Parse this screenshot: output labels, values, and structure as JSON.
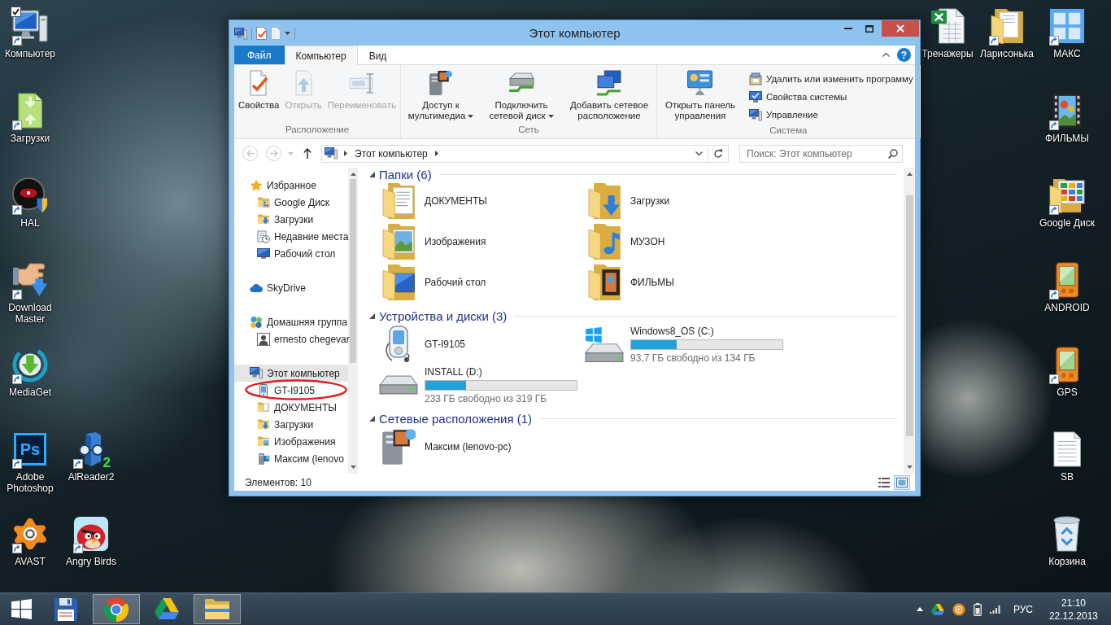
{
  "desktop": {
    "icons": [
      {
        "label": "Компьютер",
        "kind": "computer",
        "shortcut": true,
        "checked": true
      },
      {
        "label": "Загрузки",
        "kind": "arrows-folder",
        "shortcut": true,
        "checked": false
      },
      {
        "label": "HAL",
        "kind": "eye",
        "shortcut": true,
        "checked": false
      },
      {
        "label": "Download Master",
        "kind": "hand",
        "shortcut": true,
        "checked": false
      },
      {
        "label": "MediaGet",
        "kind": "ring-arrow",
        "shortcut": true,
        "checked": false
      },
      {
        "label": "Adobe Photoshop",
        "kind": "ps",
        "logo_text": "Ps",
        "shortcut": true,
        "checked": false
      },
      {
        "label": "AlReader2",
        "kind": "reader",
        "logo_text": "2",
        "shortcut": true,
        "checked": false
      },
      {
        "label": "AVAST",
        "kind": "splat",
        "shortcut": true,
        "checked": false
      },
      {
        "label": "Angry Birds",
        "kind": "bird",
        "shortcut": true,
        "checked": false
      },
      {
        "label": "Тренажеры",
        "kind": "spreadsheet",
        "shortcut": false,
        "checked": false
      },
      {
        "label": "Ларисонька",
        "kind": "folder",
        "shortcut": true,
        "checked": false
      },
      {
        "label": "МАКС",
        "kind": "tiles",
        "shortcut": true,
        "checked": false
      },
      {
        "label": "ФИЛЬМЫ",
        "kind": "film",
        "shortcut": true,
        "checked": false
      },
      {
        "label": "Google Диск",
        "kind": "folder-grid",
        "shortcut": true,
        "checked": false
      },
      {
        "label": "ANDROID",
        "kind": "handheld",
        "shortcut": true,
        "checked": false
      },
      {
        "label": "GPS",
        "kind": "handheld",
        "shortcut": true,
        "checked": false
      },
      {
        "label": "SB",
        "kind": "text-file",
        "shortcut": false,
        "checked": false
      },
      {
        "label": "Корзина",
        "kind": "bin",
        "shortcut": false,
        "checked": false
      }
    ]
  },
  "window": {
    "title": "Этот компьютер",
    "ribbon": {
      "tabs": [
        {
          "label": "Файл",
          "kind": "file",
          "selected": false
        },
        {
          "label": "Компьютер",
          "kind": "tab",
          "selected": true
        },
        {
          "label": "Вид",
          "kind": "tab",
          "selected": false
        }
      ],
      "help": "?",
      "groups": [
        {
          "label": "Расположение",
          "commands": [
            {
              "label": "Свойства",
              "kind": "properties",
              "disabled": false,
              "dropdown": false
            },
            {
              "label": "Открыть",
              "kind": "open",
              "disabled": true,
              "dropdown": false
            },
            {
              "label": "Переименовать",
              "kind": "rename",
              "disabled": true,
              "dropdown": false
            }
          ]
        },
        {
          "label": "Сеть",
          "commands": [
            {
              "label": "Доступ к мультимедиа",
              "kind": "media",
              "disabled": false,
              "dropdown": true
            },
            {
              "label": "Подключить сетевой диск",
              "kind": "map-drive",
              "disabled": false,
              "dropdown": true
            },
            {
              "label": "Добавить сетевое расположение",
              "kind": "add-location",
              "disabled": false,
              "dropdown": false
            }
          ]
        },
        {
          "label": "Система",
          "commands": [
            {
              "label": "Открыть панель управления",
              "kind": "control-panel",
              "disabled": false,
              "dropdown": false
            }
          ],
          "links": [
            {
              "label": "Удалить или изменить программу",
              "kind": "uninstall"
            },
            {
              "label": "Свойства системы",
              "kind": "system-properties"
            },
            {
              "label": "Управление",
              "kind": "manage"
            }
          ]
        }
      ]
    },
    "address": {
      "buttons": [
        {
          "kind": "back",
          "disabled": true
        },
        {
          "kind": "forward",
          "disabled": true
        },
        {
          "kind": "up",
          "disabled": false
        }
      ],
      "path": [
        "Этот компьютер"
      ],
      "search": {
        "placeholder": "Поиск: Этот компьютер"
      }
    },
    "nav": {
      "items": [
        {
          "label": "Избранное",
          "kind": "star",
          "selected": false,
          "circled": false,
          "children": [
            {
              "label": "Google Диск",
              "kind": "folder-grid",
              "selected": false,
              "circled": false
            },
            {
              "label": "Загрузки",
              "kind": "folder-download",
              "selected": false,
              "circled": false
            },
            {
              "label": "Недавние места",
              "kind": "recent",
              "selected": false,
              "circled": false
            },
            {
              "label": "Рабочий стол",
              "kind": "desktop",
              "selected": false,
              "circled": false
            }
          ]
        },
        {
          "label": "SkyDrive",
          "kind": "cloud",
          "selected": false,
          "circled": false
        },
        {
          "label": "Домашняя группа",
          "kind": "homegroup",
          "selected": false,
          "circled": false,
          "children": [
            {
              "label": "ernesto chegevar",
              "kind": "user",
              "selected": false,
              "circled": false
            }
          ]
        },
        {
          "label": "Этот компьютер",
          "kind": "computer",
          "selected": true,
          "circled": false,
          "children": [
            {
              "label": "GT-I9105",
              "kind": "phone",
              "selected": false,
              "circled": true
            },
            {
              "label": "ДОКУМЕНТЫ",
              "kind": "folder-docs",
              "selected": false,
              "circled": false
            },
            {
              "label": "Загрузки",
              "kind": "folder-download",
              "selected": false,
              "circled": false
            },
            {
              "label": "Изображения",
              "kind": "folder-pictures",
              "selected": false,
              "circled": false
            },
            {
              "label": "Максим (lenovo",
              "kind": "media-server",
              "selected": false,
              "circled": false
            }
          ]
        }
      ]
    },
    "content": {
      "groups": [
        {
          "label": "Папки (6)",
          "expanded": true,
          "items": [
            {
              "label": "ДОКУМЕНТЫ",
              "kind": "folder-docs"
            },
            {
              "label": "Загрузки",
              "kind": "folder-download"
            },
            {
              "label": "Изображения",
              "kind": "folder-pictures"
            },
            {
              "label": "МУЗОН",
              "kind": "folder-music"
            },
            {
              "label": "Рабочий стол",
              "kind": "folder-desktop"
            },
            {
              "label": "ФИЛЬМЫ",
              "kind": "folder-films"
            }
          ]
        },
        {
          "label": "Устройства и диски (3)",
          "expanded": true,
          "items": [
            {
              "label": "GT-I9105",
              "kind": "phone"
            },
            {
              "label": "Windows8_OS (C:)",
              "kind": "system-drive",
              "level": 0.3,
              "free": "93,7 ГБ свободно из 134 ГБ"
            },
            {
              "label": "INSTALL (D:)",
              "kind": "drive",
              "level": 0.27,
              "free": "233 ГБ свободно из 319 ГБ"
            }
          ]
        },
        {
          "label": "Сетевые расположения (1)",
          "expanded": true,
          "items": [
            {
              "label": "Максим (lenovo-pc)",
              "kind": "media-server"
            }
          ]
        }
      ]
    },
    "status": {
      "count": "Элементов: 10",
      "views": [
        {
          "kind": "details",
          "selected": false
        },
        {
          "kind": "large-icons",
          "selected": true
        }
      ]
    }
  },
  "taskbar": {
    "apps": [
      {
        "kind": "floppy",
        "running": false
      },
      {
        "kind": "browser",
        "running": true
      },
      {
        "kind": "drive",
        "running": false
      },
      {
        "kind": "explorer",
        "running": true
      }
    ],
    "language": "РУС",
    "time": "21:10",
    "date": "22.12.2013"
  }
}
